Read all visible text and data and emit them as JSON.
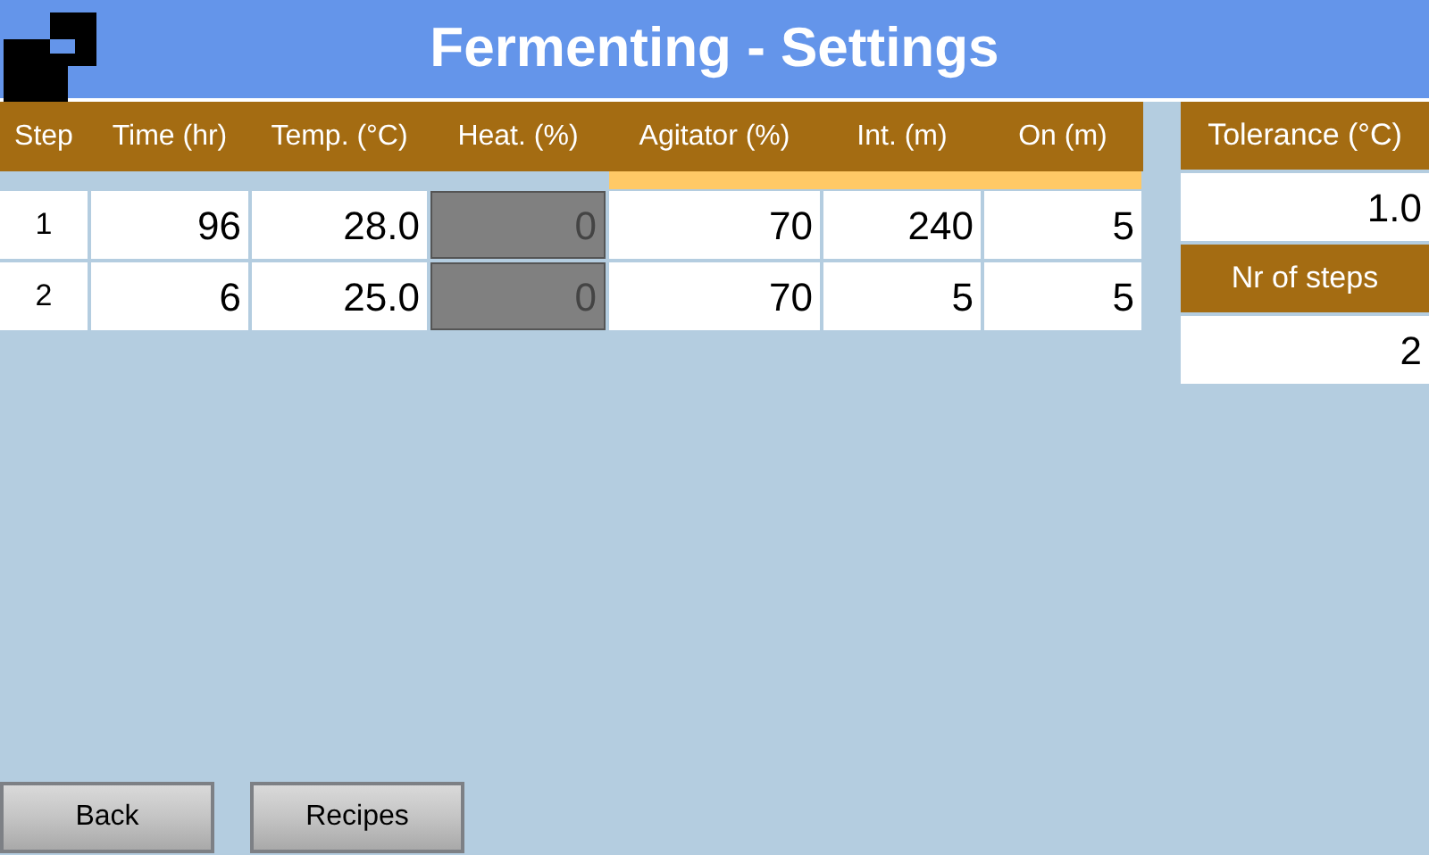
{
  "header": {
    "title": "Fermenting - Settings"
  },
  "table": {
    "columns": [
      {
        "label": "Step",
        "highlighted": false,
        "disabled": false
      },
      {
        "label": "Time (hr)",
        "highlighted": false,
        "disabled": false
      },
      {
        "label": "Temp. (°C)",
        "highlighted": false,
        "disabled": false
      },
      {
        "label": "Heat. (%)",
        "highlighted": false,
        "disabled": true
      },
      {
        "label": "Agitator (%)",
        "highlighted": true,
        "disabled": false
      },
      {
        "label": "Int. (m)",
        "highlighted": true,
        "disabled": false
      },
      {
        "label": "On (m)",
        "highlighted": true,
        "disabled": false
      }
    ],
    "rows": [
      [
        "1",
        "96",
        "28.0",
        "0",
        "70",
        "240",
        "5"
      ],
      [
        "2",
        "6",
        "25.0",
        "0",
        "70",
        "5",
        "5"
      ]
    ]
  },
  "settings": [
    {
      "label": "Tolerance (°C)",
      "value": "1.0"
    },
    {
      "label": "Nr of steps",
      "value": "2"
    }
  ],
  "buttons": [
    "Back",
    "Recipes"
  ]
}
